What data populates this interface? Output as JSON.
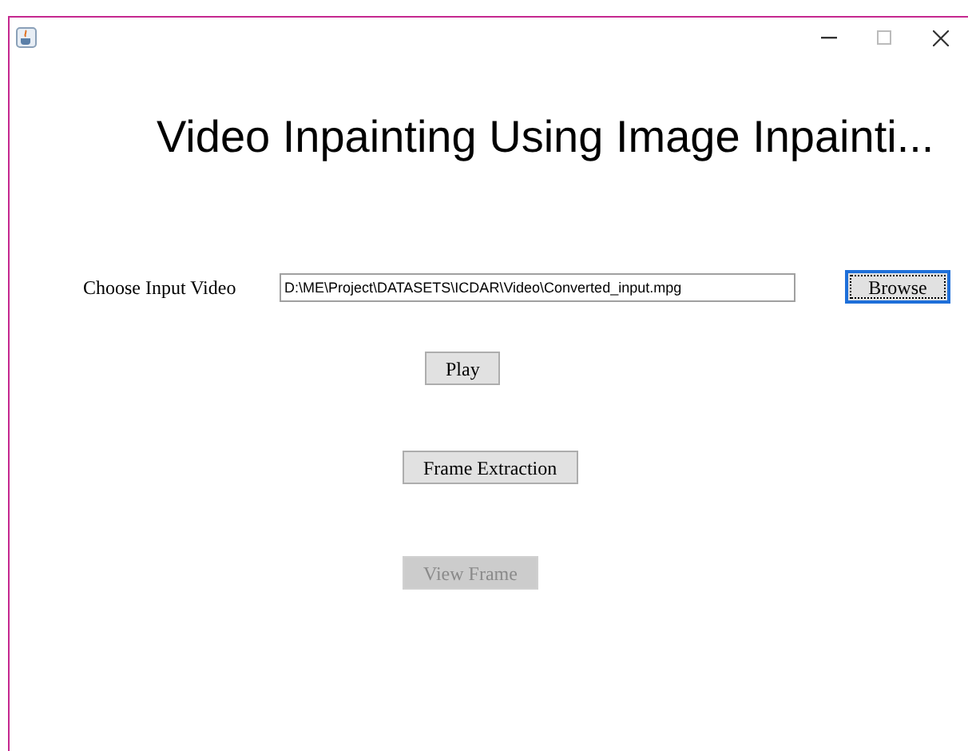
{
  "heading": "Video Inpainting Using Image Inpainti...",
  "input_row": {
    "label": "Choose Input Video",
    "value": "D:\\ME\\Project\\DATASETS\\ICDAR\\Video\\Converted_input.mpg",
    "button": {
      "label": "Browse",
      "disabled": false,
      "focused": true
    }
  },
  "buttons": [
    {
      "label": "Play",
      "disabled": false,
      "focused": false
    },
    {
      "label": "Frame Extraction",
      "disabled": false,
      "focused": false
    },
    {
      "label": "View Frame",
      "disabled": true,
      "focused": false
    }
  ]
}
